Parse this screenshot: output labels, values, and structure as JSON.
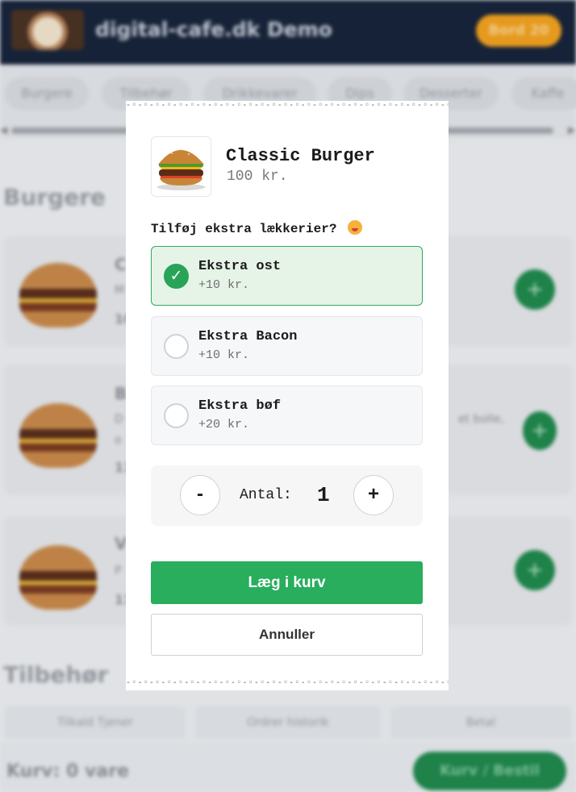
{
  "app": {
    "title": "digital-cafe.dk Demo",
    "table_badge": "Bord 20",
    "categories": [
      "Burgere",
      "Tilbehør",
      "Drikkevarer",
      "Dips",
      "Desserter",
      "Kaffe"
    ],
    "sections": {
      "burgers": "Burgere",
      "sides": "Tilbehør"
    },
    "products": [
      {
        "initial": "C",
        "desc": "M",
        "price": "10"
      },
      {
        "initial": "B",
        "desc": "D",
        "desc_tail": "et bolle,",
        "desc2": "o",
        "price": "11"
      },
      {
        "initial": "V",
        "desc": "P",
        "price": "11"
      }
    ],
    "add_glyph": "+",
    "bottom_nav": {
      "waiter": "Tilkald Tjener",
      "history": "Ordrer historik",
      "pay": "Betal"
    },
    "cart_status": "Kurv: 0 vare",
    "order_button": "Kurv / Bestil"
  },
  "modal": {
    "item_name": "Classic Burger",
    "item_price": "100 kr.",
    "extras_heading": "Tilføj ekstra lækkerier?",
    "extras": [
      {
        "name": "Ekstra ost",
        "price": "+10 kr.",
        "selected": true
      },
      {
        "name": "Ekstra Bacon",
        "price": "+10 kr.",
        "selected": false
      },
      {
        "name": "Ekstra bøf",
        "price": "+20 kr.",
        "selected": false
      }
    ],
    "check_glyph": "✓",
    "quantity": {
      "minus": "-",
      "label": "Antal:",
      "value": "1",
      "plus": "+"
    },
    "add_to_cart": "Læg i kurv",
    "cancel": "Annuller"
  },
  "colors": {
    "brand_dark": "#17243a",
    "accent_green": "#28ae5d",
    "badge_orange": "#f3a31e"
  }
}
